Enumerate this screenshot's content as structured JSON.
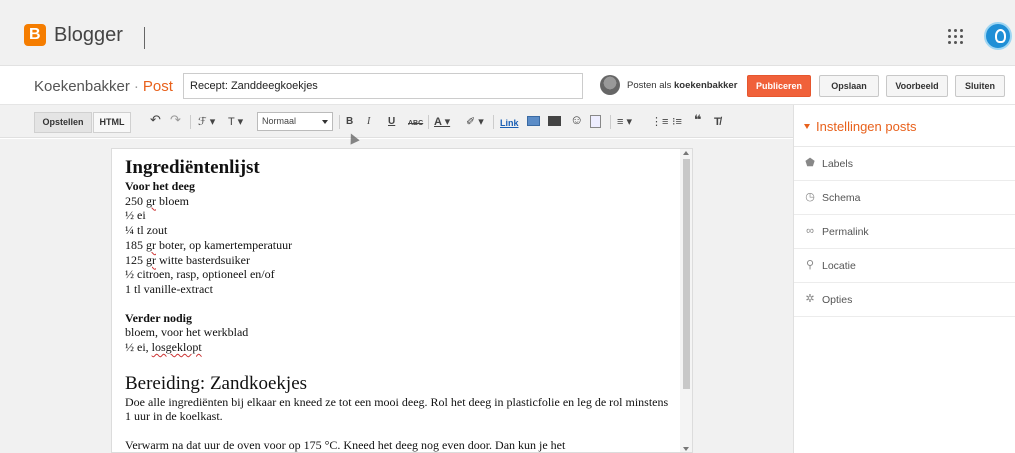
{
  "app": {
    "brand": "Blogger",
    "logo_letter": "B"
  },
  "header": {
    "blog_name": "Koekenbakker",
    "separator": "·",
    "section": "Post",
    "title_value": "Recept: Zanddeegkoekjes",
    "posting_as_prefix": "Posten als",
    "posting_as_user": "koekenbakker",
    "buttons": {
      "publish": "Publiceren",
      "save": "Opslaan",
      "preview": "Voorbeeld",
      "close": "Sluiten"
    }
  },
  "toolbar": {
    "compose": "Opstellen",
    "html": "HTML",
    "undo": "↶",
    "redo": "↷",
    "font": "ℱ ▾",
    "font_size": "T ▾",
    "style_value": "Normaal",
    "bold": "B",
    "italic": "I",
    "underline": "U",
    "strike": "ABC",
    "text_color": "A ▾",
    "highlight": "✐ ▾",
    "link": "Link",
    "align": "≡ ▾",
    "numbered_list": "⋮≡",
    "bullet_list": "⁝≡",
    "quote": "❝",
    "clear_format": "T̸"
  },
  "document": {
    "heading1": "Ingrediëntenlijst",
    "subheading1": "Voor het deeg",
    "ingredients": [
      {
        "pre": "250 ",
        "spell": "gr",
        "post": " bloem"
      },
      {
        "pre": "½ ei",
        "spell": "",
        "post": ""
      },
      {
        "pre": "¼ tl zout",
        "spell": "",
        "post": ""
      },
      {
        "pre": "185 ",
        "spell": "gr",
        "post": " boter, op kamertemperatuur"
      },
      {
        "pre": "125 ",
        "spell": "gr",
        "post": " witte basterdsuiker"
      },
      {
        "pre": "½ citroen, rasp, optioneel en/of",
        "spell": "",
        "post": ""
      },
      {
        "pre": "1 tl vanille-extract",
        "spell": "",
        "post": ""
      }
    ],
    "subheading2": "Verder nodig",
    "extra_line1": "bloem, voor het werkblad",
    "extra_line2_pre": "½ ei, ",
    "extra_line2_spell": "losgeklopt",
    "heading2": "Bereiding: Zandkoekjes",
    "paragraph1": "Doe alle ingrediënten bij elkaar en kneed ze tot een mooi deeg. Rol het deeg in plasticfolie en leg de rol minstens 1 uur in de koelkast.",
    "paragraph2": "Verwarm na dat uur de oven voor op 175 °C. Kneed het deeg nog even door. Dan kun je het"
  },
  "sidebar": {
    "header": "Instellingen posts",
    "items": [
      {
        "label": "Labels",
        "icon": "label-icon",
        "glyph": "⬟"
      },
      {
        "label": "Schema",
        "icon": "clock-icon",
        "glyph": "◷"
      },
      {
        "label": "Permalink",
        "icon": "link-icon",
        "glyph": "∞"
      },
      {
        "label": "Locatie",
        "icon": "location-pin-icon",
        "glyph": "⚲"
      },
      {
        "label": "Opties",
        "icon": "gear-icon",
        "glyph": "✲"
      }
    ]
  },
  "colors": {
    "accent": "#e8611c",
    "publish": "#f0613a",
    "logo": "#f57d00"
  }
}
